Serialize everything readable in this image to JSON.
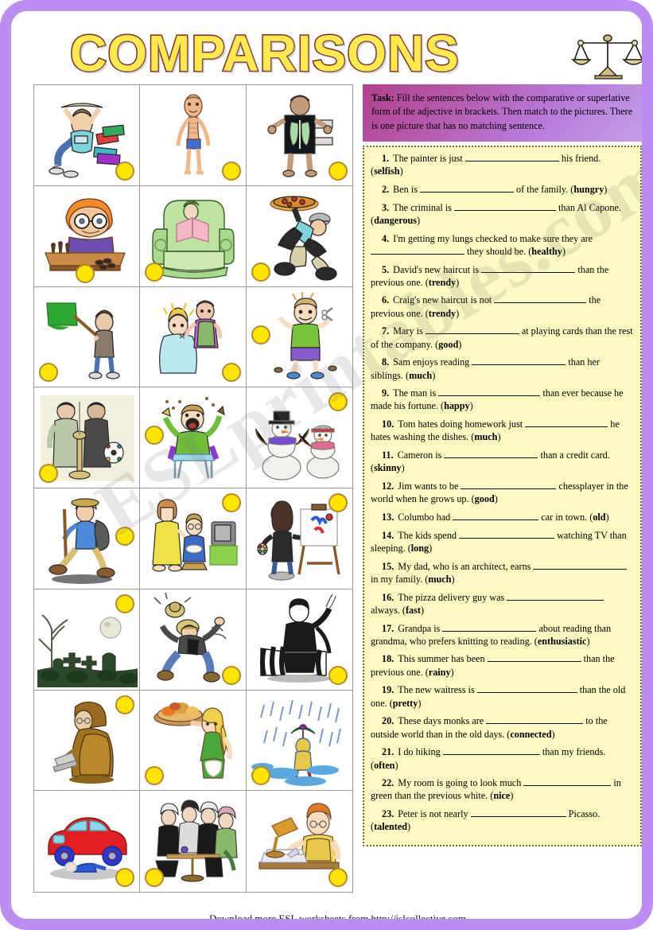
{
  "title": "COMPARISONS",
  "title_icon": "balance-scales-icon",
  "watermark": "ESLprintables.com",
  "task": {
    "label": "Task:",
    "text": " Fill the sentences below with the comparative or superlative form of the adjective in brackets. Then match to the pictures. There is one picture that has no matching sentence."
  },
  "footer": "Download more ESL worksheets from http://islcollective.com",
  "colors": {
    "frame": "#bd8ef2",
    "title_fill": "#ffe94d",
    "title_stroke": "#7e2b2b",
    "task_box": "#b657a7",
    "exercise_box": "#fcfac2",
    "answer_dot": "#ffe400"
  },
  "exercises": [
    {
      "num": "1.",
      "pre": "The painter is just ",
      "post": " his friend. (",
      "word": "selfish",
      "end": ")"
    },
    {
      "num": "2.",
      "pre": "Ben is ",
      "post": " of the family. (",
      "word": "hungry",
      "end": ")"
    },
    {
      "num": "3.",
      "pre": "The criminal is ",
      "post": " than Al Capone. (",
      "word": "dangerous",
      "end": ")"
    },
    {
      "num": "4.",
      "pre": "I'm getting my lungs checked to make sure they are ",
      "post": " they should be. (",
      "word": "healthy",
      "end": ")"
    },
    {
      "num": "5.",
      "pre": "David's new haircut is ",
      "post": " than the previous one. (",
      "word": "trendy",
      "end": ")"
    },
    {
      "num": "6.",
      "pre": "Craig's new haircut is not ",
      "post": " the previous one. (",
      "word": "trendy",
      "end": ")"
    },
    {
      "num": "7.",
      "pre": "Mary is ",
      "post": " at playing cards than the rest of the company. (",
      "word": "good",
      "end": ")"
    },
    {
      "num": "8.",
      "pre": "Sam enjoys reading ",
      "post": " than her siblings. (",
      "word": "much",
      "end": ")"
    },
    {
      "num": "9.",
      "pre": "The man is ",
      "post": " than ever because he made his fortune. (",
      "word": "happy",
      "end": ")"
    },
    {
      "num": "10.",
      "pre": "Tom hates doing homework just ",
      "post": " he hates washing the dishes. (",
      "word": "much",
      "end": ")"
    },
    {
      "num": "11.",
      "pre": "Cameron is ",
      "post": " than a credit card. (",
      "word": "skinny",
      "end": ")"
    },
    {
      "num": "12.",
      "pre": "Jim wants to be ",
      "post": " chessplayer in the world when he grows up. (",
      "word": "good",
      "end": ")"
    },
    {
      "num": "13.",
      "pre": "Columbo had ",
      "post": " car in town. (",
      "word": "old",
      "end": ")"
    },
    {
      "num": "14.",
      "pre": "The kids spend ",
      "post": " watching TV than sleeping. (",
      "word": "long",
      "end": ")"
    },
    {
      "num": "15.",
      "pre": "My dad, who is an architect, earns ",
      "post": " in my family. (",
      "word": "much",
      "end": ")"
    },
    {
      "num": "16.",
      "pre": "The pizza delivery guy was ",
      "post": " always. (",
      "word": "fast",
      "end": ")"
    },
    {
      "num": "17.",
      "pre": "Grandpa is ",
      "post": " about reading than grandma, who prefers knitting to reading. (",
      "word": "enthusiastic",
      "end": ")"
    },
    {
      "num": "18.",
      "pre": "This summer has been ",
      "post": " than the previous one. (",
      "word": "rainy",
      "end": ")"
    },
    {
      "num": "19.",
      "pre": "The new waitress is ",
      "post": " than the old one. (",
      "word": "pretty",
      "end": ")"
    },
    {
      "num": "20.",
      "pre": "These days monks are ",
      "post": " to the outside world than in the old days. (",
      "word": "connected",
      "end": ")"
    },
    {
      "num": "21.",
      "pre": "I do hiking ",
      "post": " than my friends. (",
      "word": "often",
      "end": ")"
    },
    {
      "num": "22.",
      "pre": "My room is going to look much ",
      "post": " in green than the previous white. (",
      "word": "nice",
      "end": ")"
    },
    {
      "num": "23.",
      "pre": "Peter is not nearly ",
      "post": " Picasso. (",
      "word": "talented",
      "end": ")"
    }
  ],
  "pictures": [
    {
      "id": 1,
      "name": "girl-sitting-with-books",
      "dot": "br"
    },
    {
      "id": 2,
      "name": "skinny-thin-man",
      "dot": "br"
    },
    {
      "id": 3,
      "name": "man-with-xray-of-lungs",
      "dot": "br"
    },
    {
      "id": 4,
      "name": "boy-playing-chess",
      "dot": "bc"
    },
    {
      "id": 5,
      "name": "person-reading-in-armchair",
      "dot": "bl"
    },
    {
      "id": 6,
      "name": "pizza-delivery-man-running",
      "dot": "bl"
    },
    {
      "id": 7,
      "name": "man-painting-wall-green",
      "dot": "bl"
    },
    {
      "id": 8,
      "name": "hairdresser-cutting-hair",
      "dot": "br"
    },
    {
      "id": 9,
      "name": "boy-with-scissors-bad-haircut",
      "dot": "ml"
    },
    {
      "id": 10,
      "name": "two-men-looking-at-painting",
      "dot": "bl"
    },
    {
      "id": 11,
      "name": "baby-in-highchair-eating",
      "dot": "ml"
    },
    {
      "id": 12,
      "name": "two-snowmen",
      "dot": "tr"
    },
    {
      "id": 13,
      "name": "hiker-walking-with-stick",
      "dot": "mr"
    },
    {
      "id": 14,
      "name": "family-watching-television",
      "dot": "tr"
    },
    {
      "id": 15,
      "name": "artist-painting-at-easel",
      "dot": "tr"
    },
    {
      "id": 16,
      "name": "spooky-graveyard-at-night",
      "dot": "tr"
    },
    {
      "id": 17,
      "name": "cowboy-riding-bucking-horse",
      "dot": "br"
    },
    {
      "id": 18,
      "name": "prisoner-in-striped-suit",
      "dot": "br"
    },
    {
      "id": 19,
      "name": "monk-using-laptop",
      "dot": "tr"
    },
    {
      "id": 20,
      "name": "waitress-carrying-food-tray",
      "dot": "bl"
    },
    {
      "id": 21,
      "name": "person-with-umbrella-in-rain",
      "dot": "bl"
    },
    {
      "id": 22,
      "name": "man-fixing-red-car",
      "dot": "br"
    },
    {
      "id": 23,
      "name": "women-chatting-at-cafe-table",
      "dot": "bl"
    },
    {
      "id": 24,
      "name": "boy-doing-homework-at-desk",
      "dot": "br"
    }
  ]
}
